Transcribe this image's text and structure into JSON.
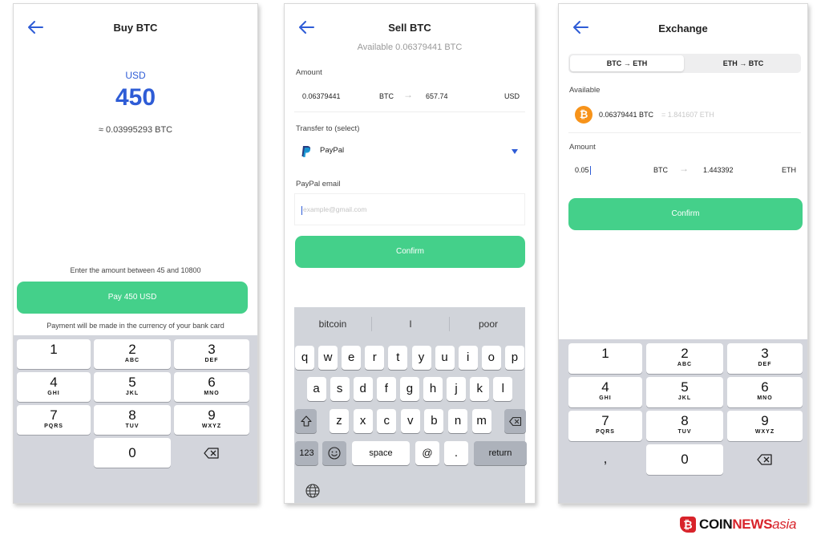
{
  "colors": {
    "accent_blue": "#2e5cd6",
    "confirm_green": "#44d08a",
    "btc_orange": "#f7931a",
    "brand_red": "#d8232a"
  },
  "buy": {
    "title": "Buy BTC",
    "currency": "USD",
    "amount": "450",
    "btc_equiv": "≈ 0.03995293 BTC",
    "range_hint": "Enter the amount between 45 and 10800",
    "pay_button": "Pay 450 USD",
    "payment_note": "Payment will be made in the currency of your bank card"
  },
  "sell": {
    "title": "Sell BTC",
    "available": "Available 0.06379441 BTC",
    "amount_label": "Amount",
    "btc_value": "0.06379441",
    "btc_unit": "BTC",
    "usd_value": "657.74",
    "usd_unit": "USD",
    "transfer_label": "Transfer to (select)",
    "transfer_value": "PayPal",
    "email_label": "PayPal email",
    "email_placeholder": "example@gmail.com",
    "confirm": "Confirm"
  },
  "keyboard": {
    "suggestions": [
      "bitcoin",
      "I",
      "poor"
    ],
    "row1": [
      "q",
      "w",
      "e",
      "r",
      "t",
      "y",
      "u",
      "i",
      "o",
      "p"
    ],
    "row2": [
      "a",
      "s",
      "d",
      "f",
      "g",
      "h",
      "j",
      "k",
      "l"
    ],
    "row3": [
      "z",
      "x",
      "c",
      "v",
      "b",
      "n",
      "m"
    ],
    "numbers": "123",
    "space": "space",
    "at": "@",
    "dot": ".",
    "return": "return"
  },
  "exchange": {
    "title": "Exchange",
    "tab_btc_eth": "BTC → ETH",
    "tab_eth_btc": "ETH → BTC",
    "available_label": "Available",
    "available_btc": "0.06379441 BTC",
    "available_eth": "= 1.841607 ETH",
    "amount_label": "Amount",
    "btc_value": "0.05",
    "btc_unit": "BTC",
    "eth_value": "1.443392",
    "eth_unit": "ETH",
    "confirm": "Confirm"
  },
  "numpad": {
    "keys": [
      {
        "d": "1",
        "l": ""
      },
      {
        "d": "2",
        "l": "ABC"
      },
      {
        "d": "3",
        "l": "DEF"
      },
      {
        "d": "4",
        "l": "GHI"
      },
      {
        "d": "5",
        "l": "JKL"
      },
      {
        "d": "6",
        "l": "MNO"
      },
      {
        "d": "7",
        "l": "PQRS"
      },
      {
        "d": "8",
        "l": "TUV"
      },
      {
        "d": "9",
        "l": "WXYZ"
      }
    ],
    "zero": "0",
    "comma": ","
  },
  "logo": {
    "coin": "COIN",
    "news": "NEWS",
    "asia": "asia"
  }
}
